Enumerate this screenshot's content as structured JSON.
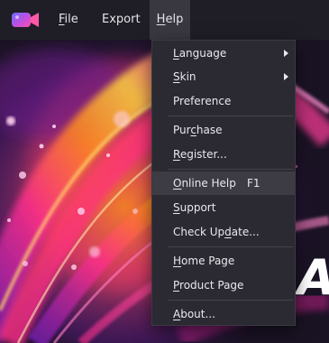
{
  "menubar": {
    "logo_icon": "video-camera-logo-icon",
    "items": [
      {
        "label": "File",
        "mnemonic": "F",
        "rest": "ile"
      },
      {
        "label": "Export",
        "mnemonic": "",
        "rest": "Export"
      },
      {
        "label": "Help",
        "mnemonic": "H",
        "rest": "elp"
      }
    ],
    "active_menu": "Help"
  },
  "help_menu": {
    "language": {
      "pre": "",
      "mn": "L",
      "post": "anguage",
      "submenu": true
    },
    "skin": {
      "pre": "",
      "mn": "S",
      "post": "kin",
      "submenu": true
    },
    "preference": {
      "pre": "Preference",
      "mn": "",
      "post": ""
    },
    "purchase": {
      "pre": "Pur",
      "mn": "c",
      "post": "hase"
    },
    "register": {
      "pre": "",
      "mn": "R",
      "post": "egister..."
    },
    "online_help": {
      "pre": "",
      "mn": "O",
      "post": "nline Help",
      "shortcut": "F1",
      "highlighted": true
    },
    "support": {
      "pre": "",
      "mn": "S",
      "post": "upport"
    },
    "check_update": {
      "pre": "Check Up",
      "mn": "d",
      "post": "ate..."
    },
    "home_page": {
      "pre": "",
      "mn": "H",
      "post": "ome Page"
    },
    "product_page": {
      "pre": "",
      "mn": "P",
      "post": "roduct Page"
    },
    "about": {
      "pre": "",
      "mn": "A",
      "post": "bout..."
    }
  },
  "background": {
    "hero_letter": "A",
    "colors": {
      "base": "#1a1324",
      "pink": "#ff2e8c",
      "orange": "#ff8a1e",
      "purple": "#8a2be2",
      "yellow": "#ffd23f"
    }
  }
}
